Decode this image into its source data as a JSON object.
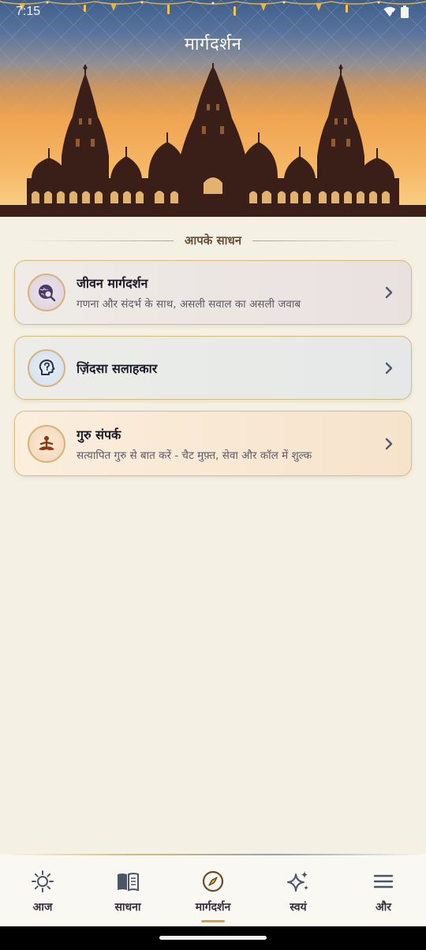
{
  "status_bar": {
    "time": "7:15"
  },
  "header": {
    "title": "मार्गदर्शन"
  },
  "section": {
    "heading": "आपके साधन"
  },
  "cards": [
    {
      "title": "जीवन मार्गदर्शन",
      "subtitle": "गणना और संदर्भ के साथ, असली सवाल का असली जवाब",
      "icon": "globe-search-icon"
    },
    {
      "title": "ज़िंदसा सलाहकार",
      "subtitle": "",
      "icon": "head-question-icon"
    },
    {
      "title": "गुरु संपर्क",
      "subtitle": "सत्यापित गुरु से बात करें - चैट मुफ़्त, सेवा और कॉल में शुल्क",
      "icon": "meditation-icon"
    }
  ],
  "bottom_nav": {
    "items": [
      {
        "label": "आज",
        "icon": "sun-icon"
      },
      {
        "label": "साधना",
        "icon": "book-icon"
      },
      {
        "label": "मार्गदर्शन",
        "icon": "compass-icon",
        "active": true
      },
      {
        "label": "स्वयं",
        "icon": "sparkles-icon"
      },
      {
        "label": "और",
        "icon": "menu-icon"
      }
    ]
  },
  "colors": {
    "background": "#f4f0e4",
    "accent_gold": "#d8bb7a",
    "active_indicator": "#d9a23d",
    "header_top": "#3e5e8e",
    "header_bottom": "#f6b866",
    "temple_silhouette": "#3a1f18"
  }
}
